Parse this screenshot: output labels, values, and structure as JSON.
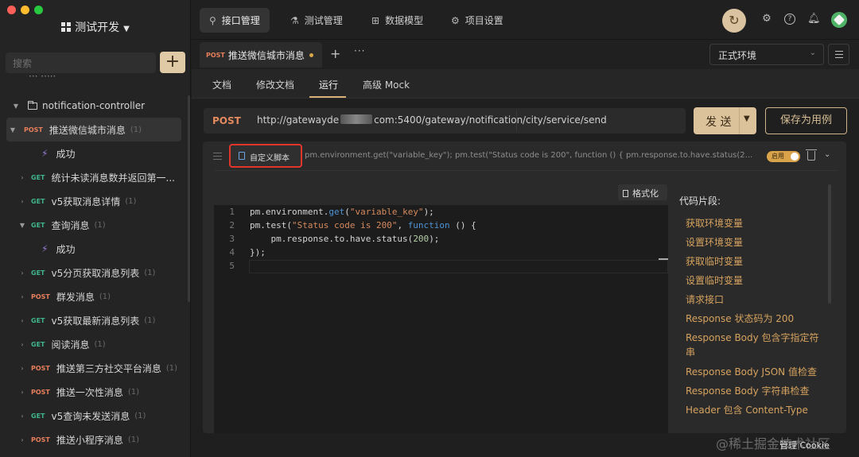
{
  "window": {
    "traffic_colors": [
      "#fe5f57",
      "#febc2e",
      "#28c840"
    ]
  },
  "workspace": {
    "name": "测试开发"
  },
  "sidebar": {
    "search_placeholder": "搜索",
    "add_label": "+",
    "partial_item": "··· ·····",
    "folder": "notification-controller",
    "items": [
      {
        "method": "POST",
        "label": "推送微信城市消息",
        "count": "(1)"
      },
      {
        "label": "成功"
      },
      {
        "method": "GET",
        "label": "统计未读消息数并返回第一..."
      },
      {
        "method": "GET",
        "label": "v5获取消息详情",
        "count": "(1)"
      },
      {
        "method": "GET",
        "label": "查询消息",
        "count": "(1)"
      },
      {
        "label": "成功"
      },
      {
        "method": "GET",
        "label": "v5分页获取消息列表",
        "count": "(1)"
      },
      {
        "method": "POST",
        "label": "群发消息",
        "count": "(1)"
      },
      {
        "method": "GET",
        "label": "v5获取最新消息列表",
        "count": "(1)"
      },
      {
        "method": "GET",
        "label": "阅读消息",
        "count": "(1)"
      },
      {
        "method": "POST",
        "label": "推送第三方社交平台消息",
        "count": "(1)"
      },
      {
        "method": "POST",
        "label": "推送一次性消息",
        "count": "(1)"
      },
      {
        "method": "GET",
        "label": "v5查询未发送消息",
        "count": "(1)"
      },
      {
        "method": "POST",
        "label": "推送小程序消息",
        "count": "(1)"
      }
    ]
  },
  "topnav": {
    "tabs": [
      {
        "icon": "link-icon",
        "label": "接口管理"
      },
      {
        "icon": "flask-icon",
        "label": "测试管理"
      },
      {
        "icon": "model-icon",
        "label": "数据模型"
      },
      {
        "icon": "gear-icon",
        "label": "项目设置"
      }
    ]
  },
  "request_tab": {
    "method": "POST",
    "title": "推送微信城市消息"
  },
  "environment": {
    "selected": "正式环境"
  },
  "subtabs": [
    "文档",
    "修改文档",
    "运行",
    "高级 Mock"
  ],
  "url_bar": {
    "method": "POST",
    "host_prefix": "http://gatewayde",
    "host_suffix": "com:5400/gateway/notification",
    "path": "/city/service/send"
  },
  "buttons": {
    "send": "发 送",
    "save_case": "保存为用例",
    "format": "格式化"
  },
  "script": {
    "chip_label": "自定义脚本",
    "preview": "pm.environment.get(\"variable_key\"); pm.test(\"Status code is 200\", function () { pm.response.to.have.status(2...",
    "toggle_label": "启用"
  },
  "editor": {
    "line_numbers": [
      "1",
      "2",
      "3",
      "4",
      "5"
    ]
  },
  "snippets": {
    "title": "代码片段:",
    "items": [
      "获取环境变量",
      "设置环境变量",
      "获取临时变量",
      "设置临时变量",
      "请求接口",
      "Response 状态码为 200",
      "Response Body 包含字指定符串",
      "Response Body JSON 值检查",
      "Response Body 字符串检查",
      "Header 包含 Content-Type"
    ]
  },
  "overlay": {
    "watermark": "@稀土掘金技术社区",
    "cookie": "管理 Cookie"
  },
  "colors": {
    "accent": "#dcc29a",
    "post": "#e67e5b",
    "get": "#3fb68b",
    "highlight": "#e0352b"
  }
}
